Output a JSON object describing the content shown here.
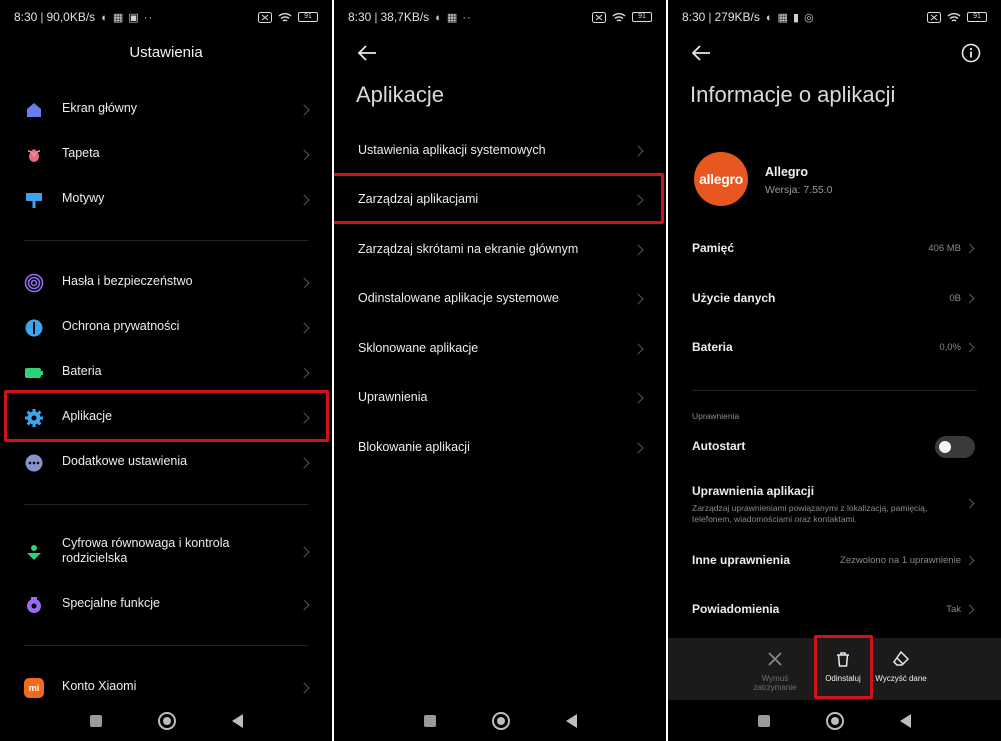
{
  "colors": {
    "highlight": "#d2121a",
    "allegro_orange": "#e8571f",
    "background": "#000000"
  },
  "screen1": {
    "status": {
      "time": "8:30",
      "speed": "90,0KB/s",
      "battery": "91"
    },
    "title": "Ustawienia",
    "items": [
      {
        "label": "Ekran główny",
        "icon": "home-icon"
      },
      {
        "label": "Tapeta",
        "icon": "flower-icon"
      },
      {
        "label": "Motywy",
        "icon": "brush-icon"
      },
      {
        "label": "Hasła i bezpieczeństwo",
        "icon": "fingerprint-icon"
      },
      {
        "label": "Ochrona prywatności",
        "icon": "shield-icon"
      },
      {
        "label": "Bateria",
        "icon": "battery-icon"
      },
      {
        "label": "Aplikacje",
        "icon": "gear-icon"
      },
      {
        "label": "Dodatkowe ustawienia",
        "icon": "more-icon"
      },
      {
        "label": "Cyfrowa równowaga i kontrola rodzicielska",
        "icon": "wellbeing-icon"
      },
      {
        "label": "Specjalne funkcje",
        "icon": "special-icon"
      },
      {
        "label": "Konto Xiaomi",
        "icon": "mi-icon",
        "icon_text": "mi"
      }
    ]
  },
  "screen2": {
    "status": {
      "time": "8:30",
      "speed": "38,7KB/s",
      "battery": "91"
    },
    "title": "Aplikacje",
    "items": [
      "Ustawienia aplikacji systemowych",
      "Zarządzaj aplikacjami",
      "Zarządzaj skrótami na ekranie głównym",
      "Odinstalowane aplikacje systemowe",
      "Sklonowane aplikacje",
      "Uprawnienia",
      "Blokowanie aplikacji"
    ]
  },
  "screen3": {
    "status": {
      "time": "8:30",
      "speed": "279KB/s",
      "battery": "91"
    },
    "title": "Informacje o aplikacji",
    "app": {
      "logo_text": "allegro",
      "name": "Allegro",
      "version": "Wersja:  7.55.0"
    },
    "rows": [
      {
        "label": "Pamięć",
        "value": "406 MB"
      },
      {
        "label": "Użycie danych",
        "value": "0B"
      },
      {
        "label": "Bateria",
        "value": "0,0%"
      }
    ],
    "section": "Uprawnienia",
    "autostart": {
      "label": "Autostart",
      "enabled": false
    },
    "permissions": {
      "label": "Uprawnienia aplikacji",
      "desc": "Zarządzaj uprawnieniami powiązanymi z lokalizacją, pamięcią, telefonem, wiadomościami oraz kontaktami."
    },
    "other": {
      "label": "Inne uprawnienia",
      "value": "Zezwolono na 1 uprawnienie"
    },
    "notifications": {
      "label": "Powiadomienia",
      "value": "Tak"
    },
    "actions": {
      "force_stop": "Wymuś zatrzymanie",
      "uninstall": "Odinstaluj",
      "clear_data": "Wyczyść dane"
    }
  }
}
